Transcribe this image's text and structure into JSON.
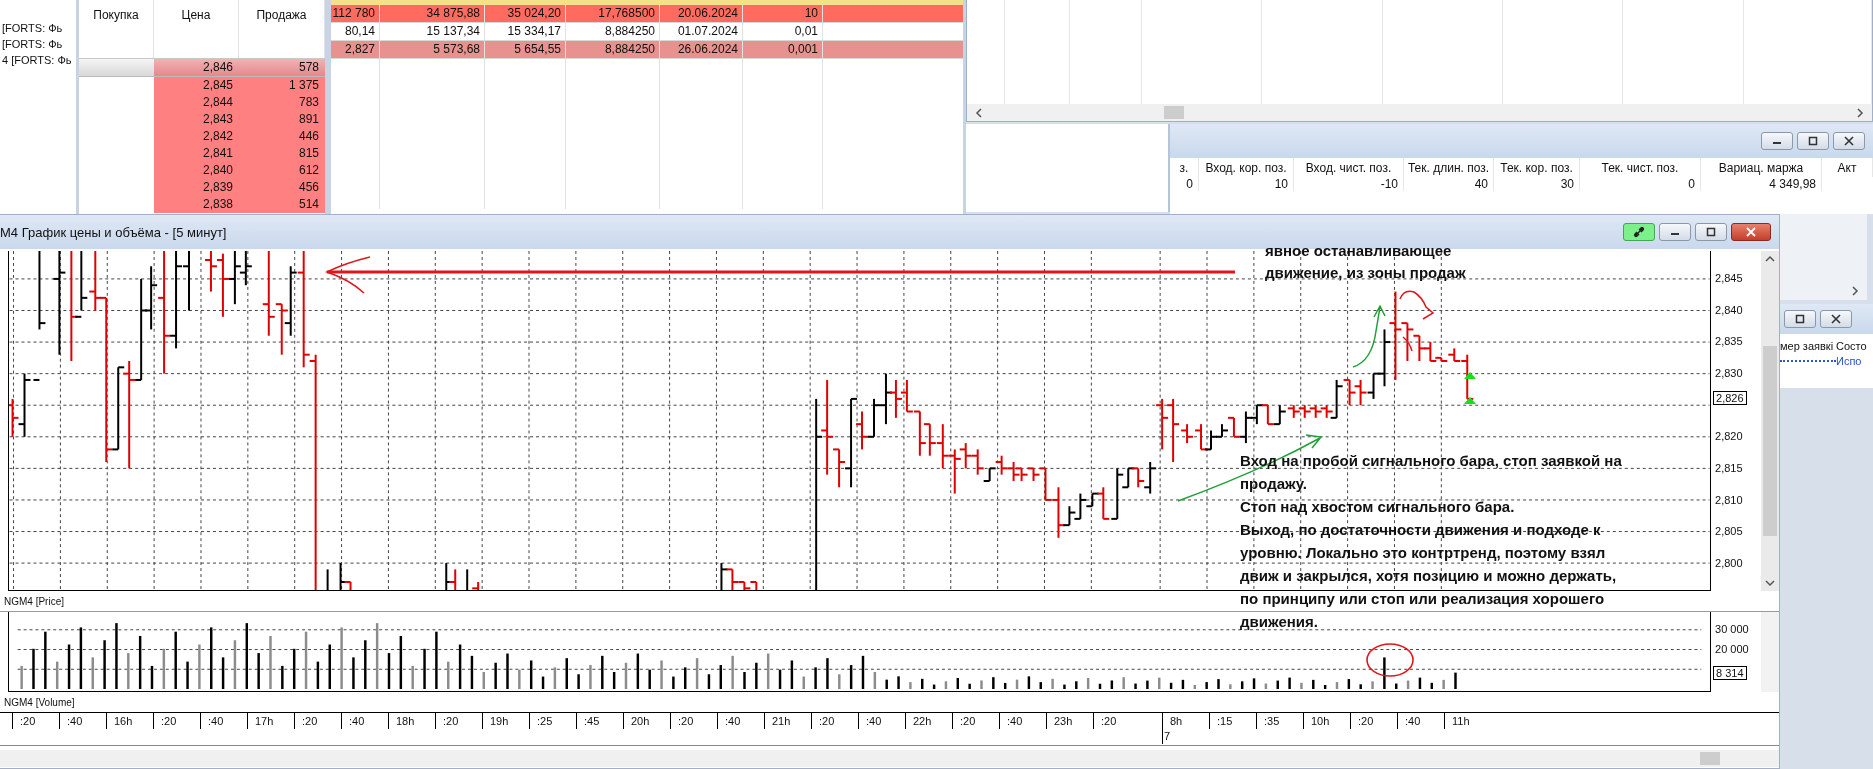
{
  "instrument_list": {
    "rows": [
      "[FORTS: Фь",
      "[FORTS: Фь",
      "4 [FORTS: Фь"
    ]
  },
  "order_book": {
    "columns": [
      "Покупка",
      "Цена",
      "Продажа"
    ],
    "rows": [
      {
        "price": "2,846",
        "sell": "578",
        "selected": true
      },
      {
        "price": "2,845",
        "sell": "1 375",
        "selected": false
      },
      {
        "price": "2,844",
        "sell": "783",
        "selected": false
      },
      {
        "price": "2,843",
        "sell": "891",
        "selected": false
      },
      {
        "price": "2,842",
        "sell": "446",
        "selected": false
      },
      {
        "price": "2,841",
        "sell": "815",
        "selected": false
      },
      {
        "price": "2,840",
        "sell": "612",
        "selected": false
      },
      {
        "price": "2,839",
        "sell": "456",
        "selected": false
      },
      {
        "price": "2,838",
        "sell": "514",
        "selected": false
      }
    ]
  },
  "securities_table": {
    "rows": [
      {
        "color": "#ff6b5e",
        "cells": [
          "112 780",
          "34 875,88",
          "35 024,20",
          "17,768500",
          "20.06.2024",
          "10"
        ]
      },
      {
        "color": "#ffffff",
        "cells": [
          "80,14",
          "15 137,34",
          "15 334,17",
          "8,884250",
          "01.07.2024",
          "0,01"
        ]
      },
      {
        "color": "#e8928f",
        "cells": [
          "2,827",
          "5 573,68",
          "5 654,55",
          "8,884250",
          "26.06.2024",
          "0,001"
        ]
      }
    ]
  },
  "positions_window": {
    "columns": [
      "з.",
      "Вход. кор. поз.",
      "Вход. чист. поз.",
      "Тек. длин. поз.",
      "Тек. кор. поз.",
      "Тек. чист. поз.",
      "Вариац. маржа",
      "Акт"
    ],
    "values": [
      "0",
      "10",
      "-10",
      "40",
      "30",
      "0",
      "4 349,98"
    ]
  },
  "orders_window": {
    "columns": [
      "мер заявкі",
      "Состо"
    ],
    "status": "Испо"
  },
  "chart_window": {
    "title": "M4 График цены и объёма - [5 минут]",
    "link_active": true,
    "price_ticks_above": [
      "2,845",
      "2,840",
      "2,835",
      "2,830"
    ],
    "price_ticks_below": [
      "2,820",
      "2,815",
      "2,810",
      "2,805",
      "2,800"
    ],
    "current_price": "2,826",
    "price_pane_label": "NGM4 [Price]",
    "volume_ticks": [
      "30 000",
      "20 000"
    ],
    "current_volume": "8 314",
    "volume_pane_label": "NGM4 [Volume]",
    "time_labels": [
      {
        "label": ":20",
        "day_break": false
      },
      {
        "label": ":40",
        "day_break": false
      },
      {
        "label": "16h",
        "day_break": false
      },
      {
        "label": ":20",
        "day_break": false
      },
      {
        "label": ":40",
        "day_break": false
      },
      {
        "label": "17h",
        "day_break": false
      },
      {
        "label": ":20",
        "day_break": false
      },
      {
        "label": ":40",
        "day_break": false
      },
      {
        "label": "18h",
        "day_break": false
      },
      {
        "label": ":20",
        "day_break": false
      },
      {
        "label": "19h",
        "day_break": false
      },
      {
        "label": ":25",
        "day_break": false
      },
      {
        "label": ":45",
        "day_break": false
      },
      {
        "label": "20h",
        "day_break": false
      },
      {
        "label": ":20",
        "day_break": false
      },
      {
        "label": ":40",
        "day_break": false
      },
      {
        "label": "21h",
        "day_break": false
      },
      {
        "label": ":20",
        "day_break": false
      },
      {
        "label": ":40",
        "day_break": false
      },
      {
        "label": "22h",
        "day_break": false
      },
      {
        "label": ":20",
        "day_break": false
      },
      {
        "label": ":40",
        "day_break": false
      },
      {
        "label": "23h",
        "day_break": false
      },
      {
        "label": ":20",
        "day_break": false
      },
      {
        "label": "8h",
        "day_break": true,
        "date": "7"
      },
      {
        "label": ":15",
        "day_break": false
      },
      {
        "label": ":35",
        "day_break": false
      },
      {
        "label": "10h",
        "day_break": false
      },
      {
        "label": ":20",
        "day_break": false
      },
      {
        "label": ":40",
        "day_break": false
      },
      {
        "label": "11h",
        "day_break": false
      }
    ]
  },
  "annotations": [
    {
      "kind": "top",
      "text": "явное останавливающее\nдвижение, из зоны продаж"
    },
    {
      "kind": "bottom",
      "text": "Вход на пробой сигнального бара, стоп заявкой на\nпродажу.\nСтоп над хвостом сигнального бара.\nВыход, по достаточности движения и подходе к\nуровню. Локально это контртренд, поэтому взял\nдвиж и закрылся, хотя позицию и можно держать,\nпо принципу или стоп или реализация хорошего\nдвижения."
    }
  ]
}
